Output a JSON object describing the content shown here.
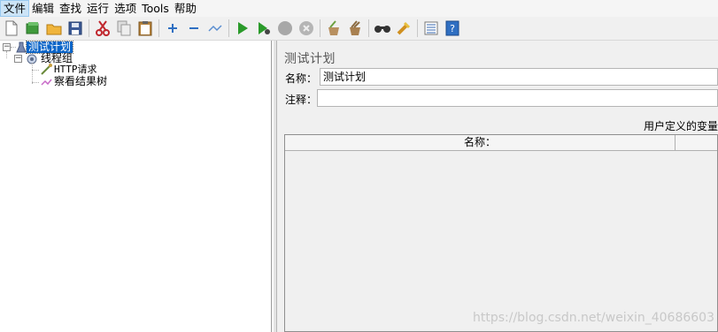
{
  "menu": [
    "文件",
    "编辑",
    "查找",
    "运行",
    "选项",
    "Tools",
    "帮助"
  ],
  "toolbar": {
    "icons": [
      "new-icon",
      "templates-icon",
      "open-icon",
      "save-icon",
      "cut-icon",
      "copy-icon",
      "paste-icon",
      "expand-icon",
      "collapse-icon",
      "toggle-icon",
      "start-icon",
      "start-no-pause-icon",
      "stop-icon",
      "shutdown-icon",
      "clear-icon",
      "clear-all-icon",
      "search-icon",
      "reset-search-icon",
      "function-helper-icon",
      "help-icon"
    ]
  },
  "tree": {
    "root": "测试计划",
    "thread_group": "线程组",
    "http_request": "HTTP请求",
    "result_tree": "察看结果树"
  },
  "panel": {
    "title": "测试计划",
    "name_label": "名称：",
    "name_value": "测试计划",
    "comment_label": "注释：",
    "comment_value": "",
    "udv_label": "用户定义的变量",
    "table_header_name": "名称："
  },
  "watermark": "https://blog.csdn.net/weixin_40686603"
}
